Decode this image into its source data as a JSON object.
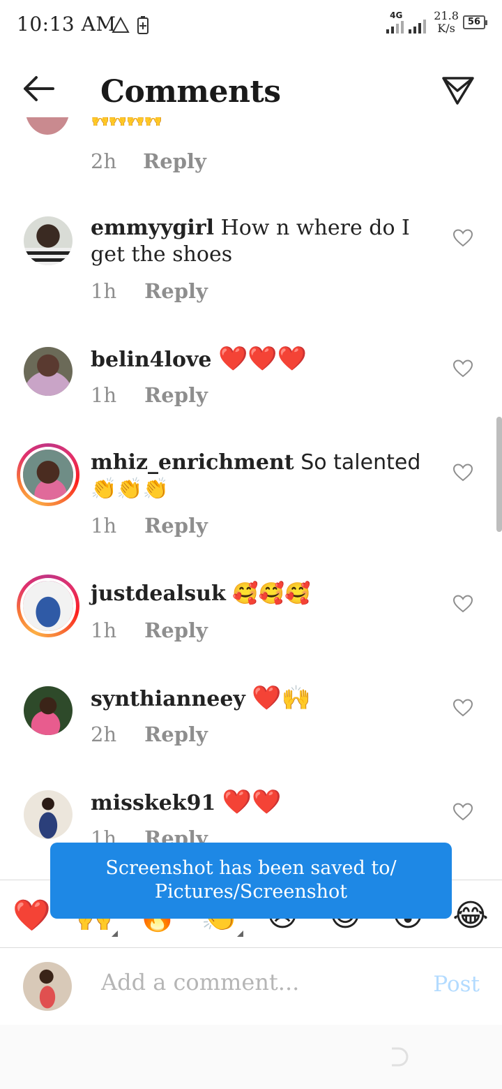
{
  "status_bar": {
    "time": "10:13 AM",
    "network": "4G",
    "speed_value": "21.8",
    "speed_unit": "K/s",
    "battery": "56"
  },
  "header": {
    "title": "Comments"
  },
  "partial_comment": {
    "time": "2h",
    "reply_label": "Reply"
  },
  "comments": [
    {
      "username": "emmyygirl",
      "text": "How n where do I get the shoes",
      "time": "1h",
      "reply_label": "Reply"
    },
    {
      "username": "belin4love",
      "text": "❤️❤️❤️",
      "time": "1h",
      "reply_label": "Reply"
    },
    {
      "username": "mhiz_enrichment",
      "text": "So talented 👏👏👏",
      "time": "1h",
      "reply_label": "Reply"
    },
    {
      "username": "justdealsuk",
      "text": "🥰🥰🥰",
      "time": "1h",
      "reply_label": "Reply"
    },
    {
      "username": "synthianneey",
      "text": "❤️🙌",
      "time": "2h",
      "reply_label": "Reply"
    },
    {
      "username": "misskek91",
      "text": "❤️❤️",
      "time": "1h",
      "reply_label": "Reply"
    }
  ],
  "toast": {
    "line1": "Screenshot has been saved to/",
    "line2": "Pictures/Screenshot"
  },
  "reactions": [
    "❤️",
    "🙌",
    "🔥",
    "👏",
    "😢",
    "😍",
    "😮",
    "😂"
  ],
  "composer": {
    "placeholder": "Add a comment...",
    "post_label": "Post"
  },
  "colors": {
    "heart": "#e0151e",
    "toast": "#1e88e5",
    "post": "#b3dbff",
    "meta": "#8e8e8e"
  }
}
